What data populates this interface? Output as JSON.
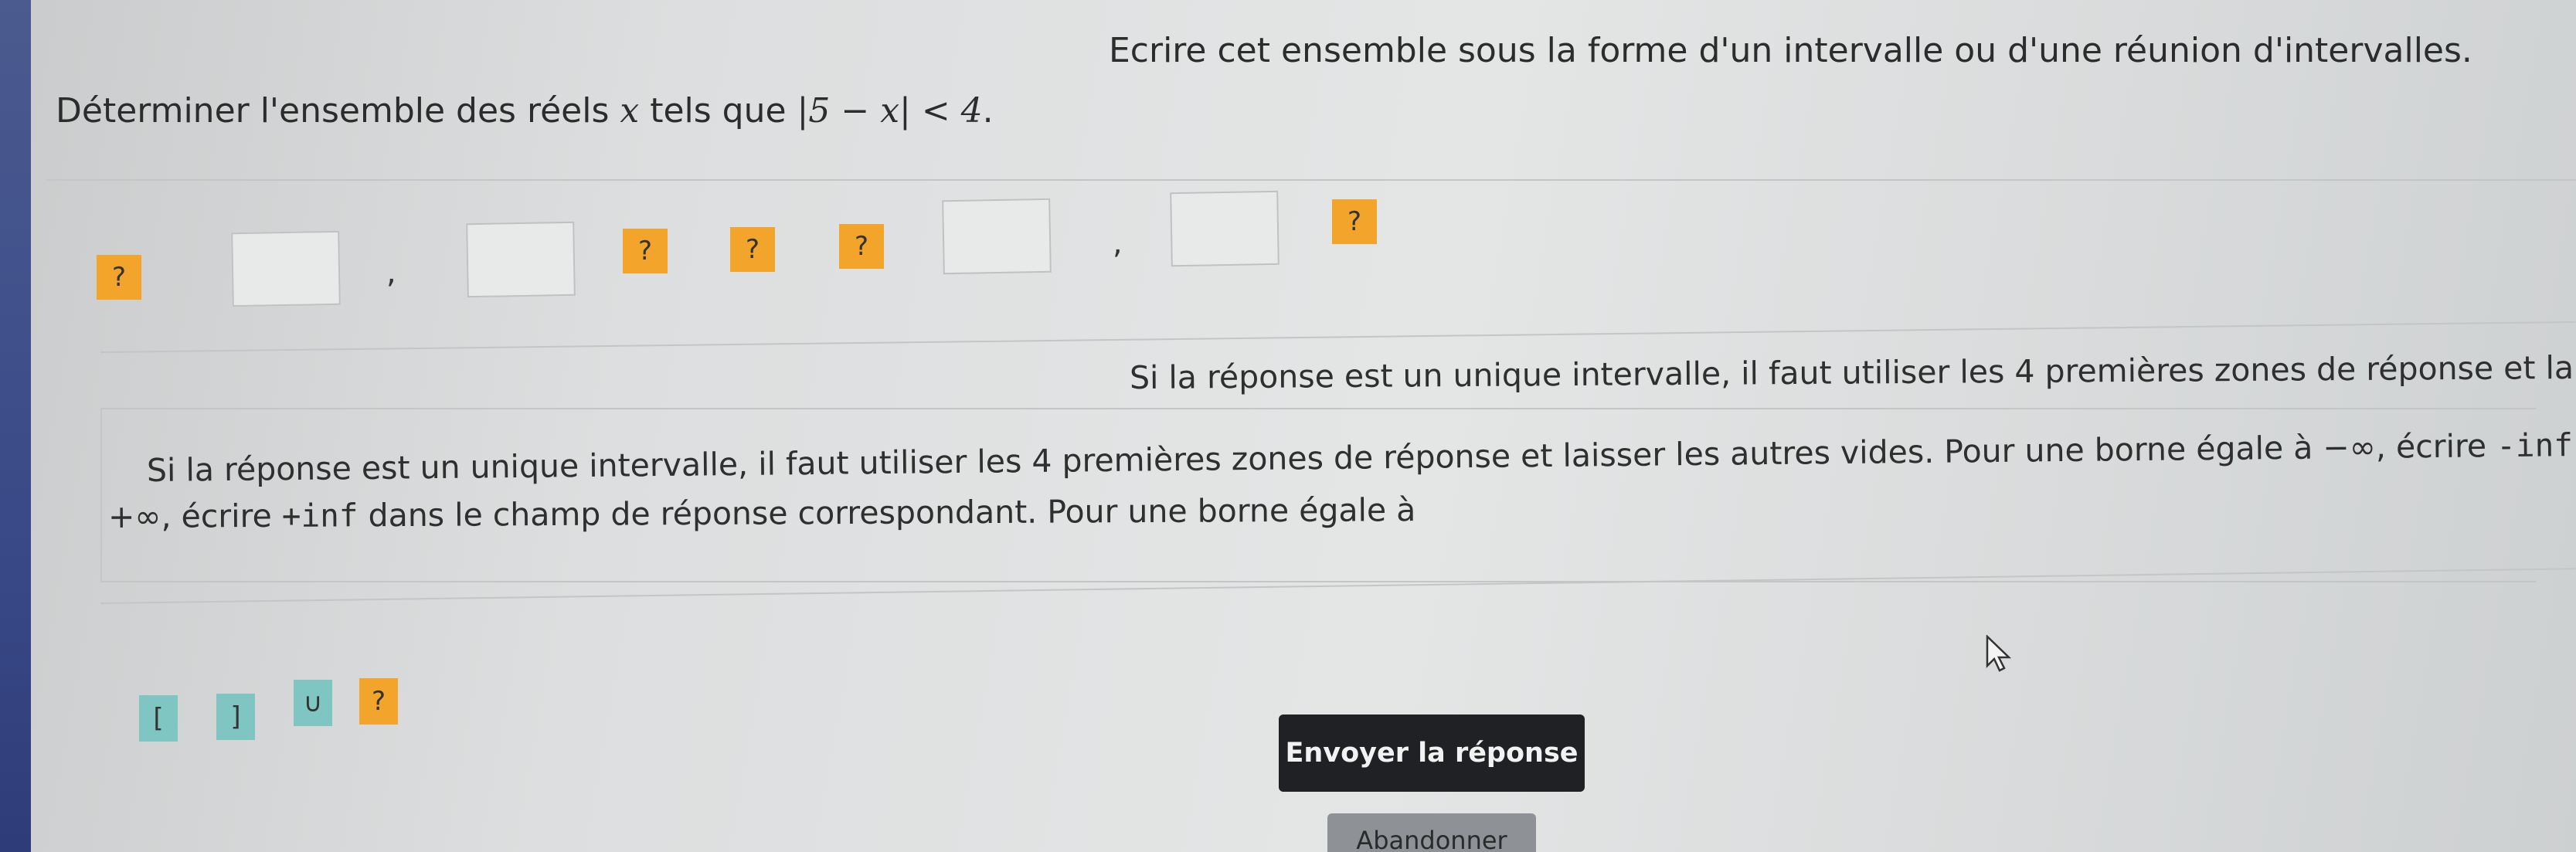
{
  "top_instruction": "Ecrire cet ensemble sous la forme d'un intervalle ou d'une réunion d'intervalles.",
  "question": {
    "prefix": "Déterminer l'ensemble des réels ",
    "var": "x",
    "middle": " tels que ",
    "expression": "|5 − x| < 4",
    "suffix": "."
  },
  "answer_row": {
    "help_label": "?",
    "comma": ","
  },
  "hint": {
    "line1": "Si la réponse est un unique intervalle, il faut utiliser les 4 premières zones de réponse et laisser les autres vides. Pour une borne égale à",
    "line2_text": "−∞, écrire ",
    "line2_code": "-inf",
    "line2_end": ".",
    "line3_text1": "+∞, écrire ",
    "line3_code": "+inf",
    "line3_text2": " dans le champ de réponse correspondant. Pour une borne égale à"
  },
  "palette": {
    "open_bracket": "[",
    "close_bracket": "]",
    "union": "∪",
    "help": "?"
  },
  "submit_label": "Envoyer la réponse",
  "abandon_label": "Abandonner",
  "colors": {
    "help_button": "#f2a52a",
    "palette_teal": "#7fc5c2",
    "submit_bg": "#1f2124"
  }
}
